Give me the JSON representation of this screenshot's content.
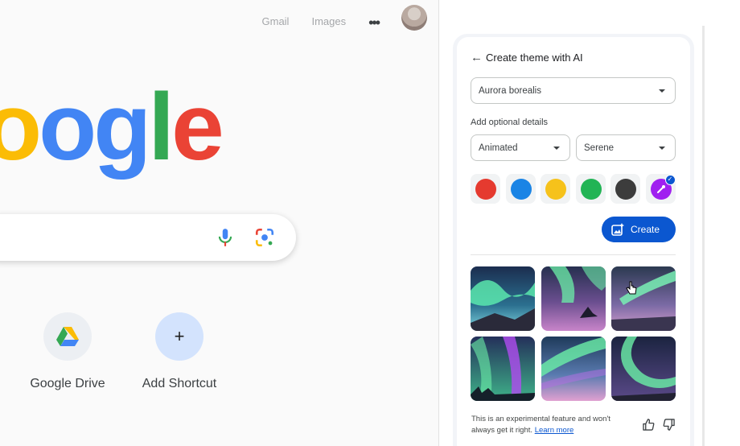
{
  "topbar": {
    "gmail": "Gmail",
    "images": "Images",
    "apps_icon": "apps-dots-icon"
  },
  "logo": {
    "letters": [
      "o",
      "o",
      "g",
      "l",
      "e"
    ],
    "colors": [
      "#fbbc05",
      "#4285f4",
      "#4285f4",
      "#34a853",
      "#ea4335"
    ]
  },
  "shortcuts": [
    {
      "label": "Google Drive",
      "icon": "google-drive-icon"
    },
    {
      "label": "Add Shortcut",
      "icon": "plus-icon"
    }
  ],
  "panel": {
    "title": "Create theme with AI",
    "subject": "Aurora borealis",
    "optional_label": "Add optional details",
    "style": "Animated",
    "mood": "Serene",
    "colors": [
      "#e53a2f",
      "#1a84e5",
      "#f6c21b",
      "#22b455",
      "#3c3c3c",
      "#a020f0"
    ],
    "create_label": "Create",
    "footer_text": "This is an experimental feature and won't always get it right.",
    "learn_more": "Learn more"
  }
}
